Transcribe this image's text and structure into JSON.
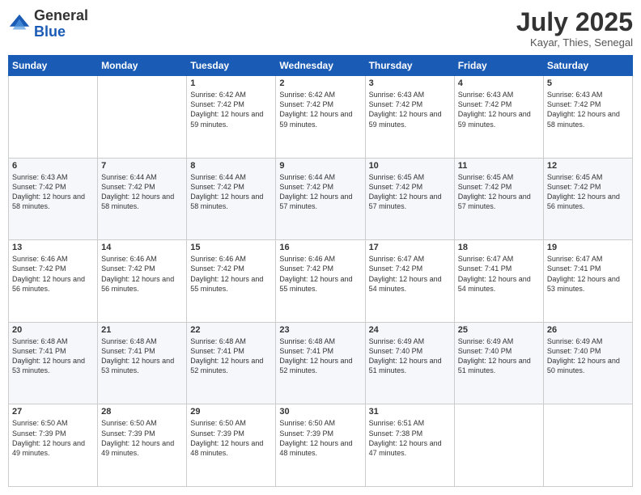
{
  "header": {
    "logo": {
      "line1": "General",
      "line2": "Blue"
    },
    "title": "July 2025",
    "location": "Kayar, Thies, Senegal"
  },
  "days_of_week": [
    "Sunday",
    "Monday",
    "Tuesday",
    "Wednesday",
    "Thursday",
    "Friday",
    "Saturday"
  ],
  "weeks": [
    [
      {
        "day": "",
        "info": ""
      },
      {
        "day": "",
        "info": ""
      },
      {
        "day": "1",
        "info": "Sunrise: 6:42 AM\nSunset: 7:42 PM\nDaylight: 12 hours and 59 minutes."
      },
      {
        "day": "2",
        "info": "Sunrise: 6:42 AM\nSunset: 7:42 PM\nDaylight: 12 hours and 59 minutes."
      },
      {
        "day": "3",
        "info": "Sunrise: 6:43 AM\nSunset: 7:42 PM\nDaylight: 12 hours and 59 minutes."
      },
      {
        "day": "4",
        "info": "Sunrise: 6:43 AM\nSunset: 7:42 PM\nDaylight: 12 hours and 59 minutes."
      },
      {
        "day": "5",
        "info": "Sunrise: 6:43 AM\nSunset: 7:42 PM\nDaylight: 12 hours and 58 minutes."
      }
    ],
    [
      {
        "day": "6",
        "info": "Sunrise: 6:43 AM\nSunset: 7:42 PM\nDaylight: 12 hours and 58 minutes."
      },
      {
        "day": "7",
        "info": "Sunrise: 6:44 AM\nSunset: 7:42 PM\nDaylight: 12 hours and 58 minutes."
      },
      {
        "day": "8",
        "info": "Sunrise: 6:44 AM\nSunset: 7:42 PM\nDaylight: 12 hours and 58 minutes."
      },
      {
        "day": "9",
        "info": "Sunrise: 6:44 AM\nSunset: 7:42 PM\nDaylight: 12 hours and 57 minutes."
      },
      {
        "day": "10",
        "info": "Sunrise: 6:45 AM\nSunset: 7:42 PM\nDaylight: 12 hours and 57 minutes."
      },
      {
        "day": "11",
        "info": "Sunrise: 6:45 AM\nSunset: 7:42 PM\nDaylight: 12 hours and 57 minutes."
      },
      {
        "day": "12",
        "info": "Sunrise: 6:45 AM\nSunset: 7:42 PM\nDaylight: 12 hours and 56 minutes."
      }
    ],
    [
      {
        "day": "13",
        "info": "Sunrise: 6:46 AM\nSunset: 7:42 PM\nDaylight: 12 hours and 56 minutes."
      },
      {
        "day": "14",
        "info": "Sunrise: 6:46 AM\nSunset: 7:42 PM\nDaylight: 12 hours and 56 minutes."
      },
      {
        "day": "15",
        "info": "Sunrise: 6:46 AM\nSunset: 7:42 PM\nDaylight: 12 hours and 55 minutes."
      },
      {
        "day": "16",
        "info": "Sunrise: 6:46 AM\nSunset: 7:42 PM\nDaylight: 12 hours and 55 minutes."
      },
      {
        "day": "17",
        "info": "Sunrise: 6:47 AM\nSunset: 7:42 PM\nDaylight: 12 hours and 54 minutes."
      },
      {
        "day": "18",
        "info": "Sunrise: 6:47 AM\nSunset: 7:41 PM\nDaylight: 12 hours and 54 minutes."
      },
      {
        "day": "19",
        "info": "Sunrise: 6:47 AM\nSunset: 7:41 PM\nDaylight: 12 hours and 53 minutes."
      }
    ],
    [
      {
        "day": "20",
        "info": "Sunrise: 6:48 AM\nSunset: 7:41 PM\nDaylight: 12 hours and 53 minutes."
      },
      {
        "day": "21",
        "info": "Sunrise: 6:48 AM\nSunset: 7:41 PM\nDaylight: 12 hours and 53 minutes."
      },
      {
        "day": "22",
        "info": "Sunrise: 6:48 AM\nSunset: 7:41 PM\nDaylight: 12 hours and 52 minutes."
      },
      {
        "day": "23",
        "info": "Sunrise: 6:48 AM\nSunset: 7:41 PM\nDaylight: 12 hours and 52 minutes."
      },
      {
        "day": "24",
        "info": "Sunrise: 6:49 AM\nSunset: 7:40 PM\nDaylight: 12 hours and 51 minutes."
      },
      {
        "day": "25",
        "info": "Sunrise: 6:49 AM\nSunset: 7:40 PM\nDaylight: 12 hours and 51 minutes."
      },
      {
        "day": "26",
        "info": "Sunrise: 6:49 AM\nSunset: 7:40 PM\nDaylight: 12 hours and 50 minutes."
      }
    ],
    [
      {
        "day": "27",
        "info": "Sunrise: 6:50 AM\nSunset: 7:39 PM\nDaylight: 12 hours and 49 minutes."
      },
      {
        "day": "28",
        "info": "Sunrise: 6:50 AM\nSunset: 7:39 PM\nDaylight: 12 hours and 49 minutes."
      },
      {
        "day": "29",
        "info": "Sunrise: 6:50 AM\nSunset: 7:39 PM\nDaylight: 12 hours and 48 minutes."
      },
      {
        "day": "30",
        "info": "Sunrise: 6:50 AM\nSunset: 7:39 PM\nDaylight: 12 hours and 48 minutes."
      },
      {
        "day": "31",
        "info": "Sunrise: 6:51 AM\nSunset: 7:38 PM\nDaylight: 12 hours and 47 minutes."
      },
      {
        "day": "",
        "info": ""
      },
      {
        "day": "",
        "info": ""
      }
    ]
  ]
}
